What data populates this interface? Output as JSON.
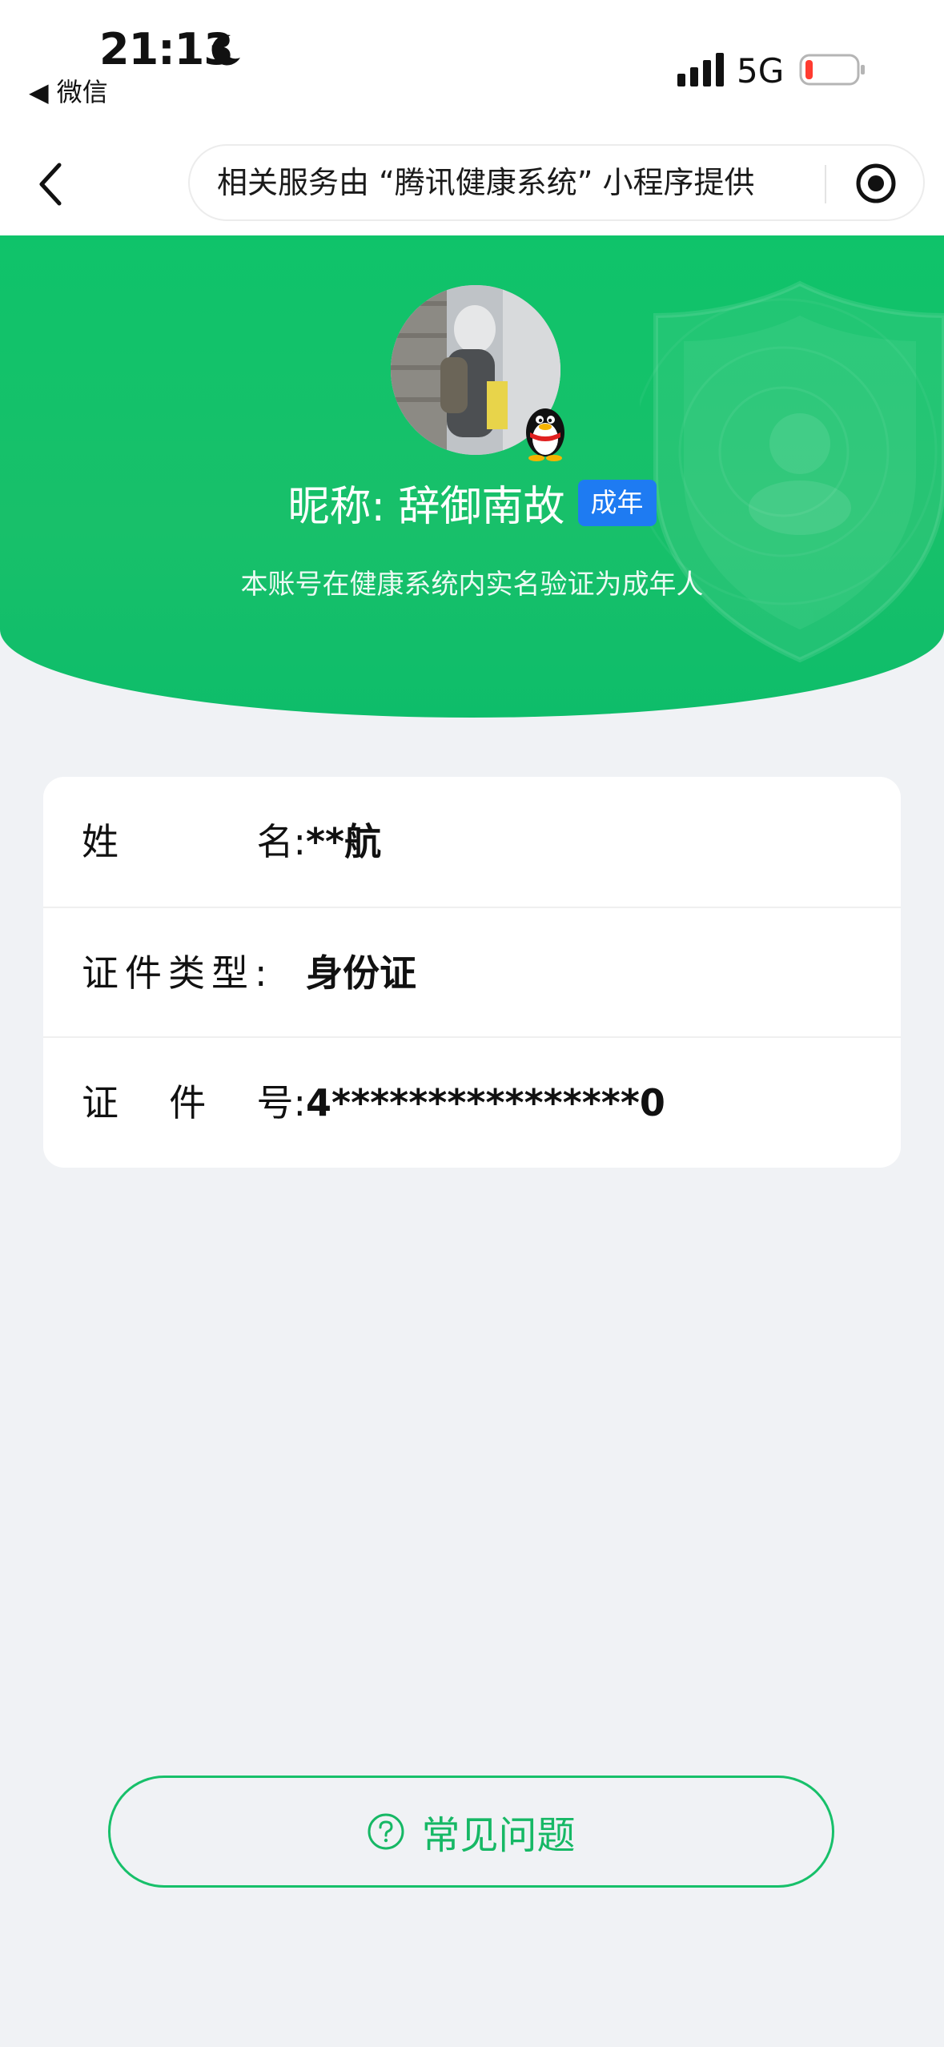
{
  "status_bar": {
    "time": "21:13",
    "back_app": "◀ 微信",
    "network": "5G",
    "battery_color": "#ff3b30"
  },
  "navbar": {
    "capsule_text": "相关服务由 “腾讯健康系统” 小程序提供"
  },
  "profile": {
    "nickname": "昵称: 辞御南故",
    "badge": "成年",
    "verify_text": "本账号在健康系统内实名验证为成年人",
    "badge_icon": "qq-penguin-icon"
  },
  "info": {
    "name_label_a": "姓",
    "name_label_b": "名:",
    "name_value": "**航",
    "idtype_label": "证件类型:",
    "idtype_value": "身份证",
    "idno_label_a": "证",
    "idno_label_b": "件",
    "idno_label_c": "号:",
    "idno_value": "4****************0"
  },
  "faq": {
    "label": "常见问题",
    "icon": "question-circle-icon"
  },
  "colors": {
    "accent_green": "#16b865",
    "badge_blue": "#1e7bf2",
    "background": "#f0f2f5"
  }
}
